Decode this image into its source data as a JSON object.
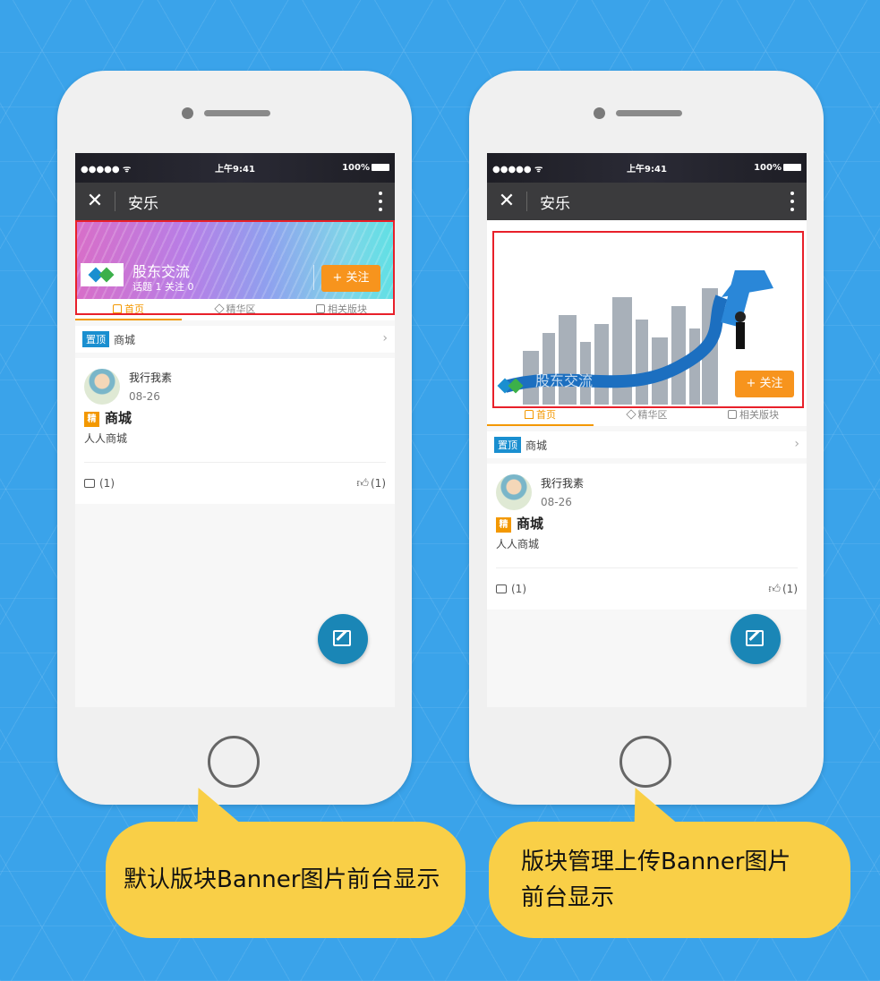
{
  "status_bar": {
    "signal": "●●●●● ᯤ",
    "time": "上午9:41",
    "battery": "100%"
  },
  "nav": {
    "close_glyph": "✕",
    "title": "安乐"
  },
  "board": {
    "name": "股东交流",
    "stats": "话题 1 关注 0",
    "follow_label": "+ 关注"
  },
  "tabs": [
    {
      "label": "首页",
      "icon": "home-icon"
    },
    {
      "label": "精华区",
      "icon": "gem-icon"
    },
    {
      "label": "相关版块",
      "icon": "cube-icon"
    }
  ],
  "pinned": {
    "badge": "置顶",
    "label": "商城"
  },
  "post": {
    "author": "我行我素",
    "date": "08-26",
    "badge": "精",
    "title": "商城",
    "summary": "人人商城",
    "comments": "(1)",
    "likes": "(1)"
  },
  "captions": {
    "left": "默认版块Banner图片前台显示",
    "right_line1": "版块管理上传Banner图片",
    "right_line2": "前台显示"
  },
  "colors": {
    "background": "#3aa3ea",
    "accent_orange": "#f7941d",
    "highlight_red": "#e8202a",
    "bubble_yellow": "#f9cf47",
    "fab_blue": "#1a86b6"
  }
}
